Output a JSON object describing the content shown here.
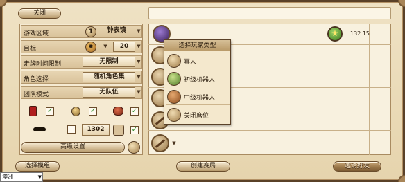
{
  "header": {
    "close_label": "关闭"
  },
  "settings": {
    "rows": [
      {
        "label": "游戏区域",
        "value": "钟表镇",
        "icon": "1"
      },
      {
        "label": "目标",
        "value": "20"
      },
      {
        "label": "走牌时间限制",
        "value": "无限制"
      },
      {
        "label": "角色选择",
        "value": "随机角色集"
      },
      {
        "label": "团队模式",
        "value": "无队伍"
      }
    ],
    "spectator_count": "1302",
    "advanced_label": "高级设置"
  },
  "player_slot": {
    "score": "132.15"
  },
  "popup": {
    "title": "选择玩家类型",
    "options": [
      "真人",
      "初级机器人",
      "中级机器人",
      "关闭席位"
    ]
  },
  "footer": {
    "select_mode_label": "选择模组",
    "create_game_label": "创建赛局",
    "invite_friends_label": "邀请好友"
  },
  "region_input": {
    "value": "澳洲"
  },
  "colors": {
    "check": "#2b8a2b",
    "badge": "#3c7d1d"
  }
}
